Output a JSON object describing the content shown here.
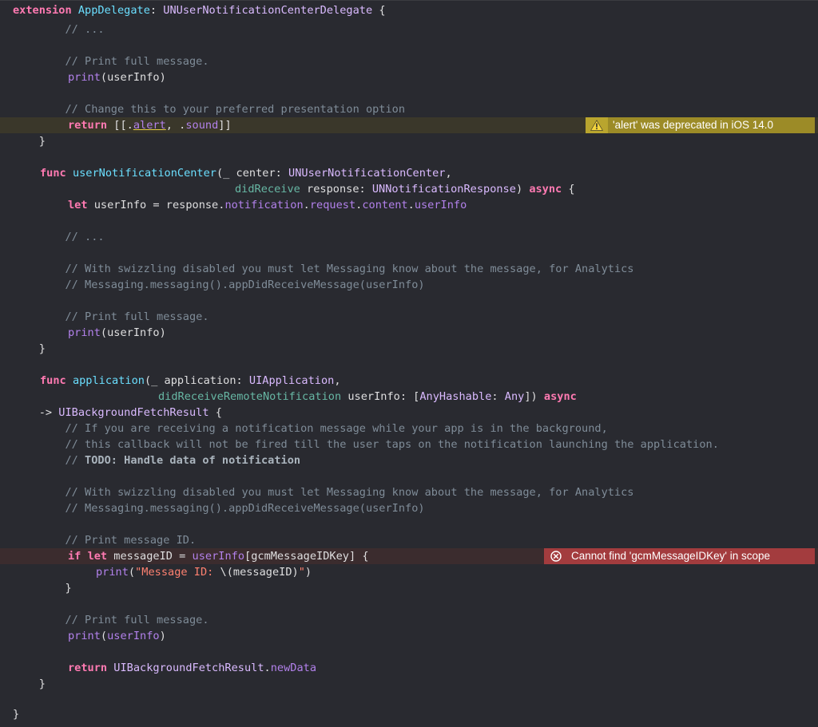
{
  "code": {
    "l1": {
      "kw": "extension",
      "type": "AppDelegate",
      "colon": ": ",
      "proto": "UNUserNotificationCenterDelegate",
      "rest": " {"
    },
    "l2": {
      "text": "        // ..."
    },
    "l4": {
      "text": "        // Print full message."
    },
    "l5": {
      "fn": "print",
      "rest": "(userInfo)"
    },
    "l7": {
      "text": "        // Change this to your preferred presentation option"
    },
    "l8": {
      "kw": "return",
      "a": " [[.",
      "alert": "alert",
      "b": ", .",
      "sound": "sound",
      "c": "]]"
    },
    "l9": {
      "text": "    }"
    },
    "l11": {
      "kw": "func",
      "name": "userNotificationCenter",
      "a": "(_ center: ",
      "type": "UNUserNotificationCenter",
      "b": ","
    },
    "l12": {
      "label": "didReceive",
      "a": " response: ",
      "type": "UNNotificationResponse",
      "b": ") ",
      "kw": "async",
      "c": " {"
    },
    "l13": {
      "kw": "let",
      "a": " userInfo = response.",
      "p1": "notification",
      "d1": ".",
      "p2": "request",
      "d2": ".",
      "p3": "content",
      "d3": ".",
      "p4": "userInfo"
    },
    "l15": {
      "text": "        // ..."
    },
    "l17": {
      "text": "        // With swizzling disabled you must let Messaging know about the message, for Analytics"
    },
    "l18": {
      "text": "        // Messaging.messaging().appDidReceiveMessage(userInfo)"
    },
    "l20": {
      "text": "        // Print full message."
    },
    "l21": {
      "fn": "print",
      "rest": "(userInfo)"
    },
    "l22": {
      "text": "    }"
    },
    "l24": {
      "kw": "func",
      "name": "application",
      "a": "(_ application: ",
      "type": "UIApplication",
      "b": ","
    },
    "l25": {
      "label": "didReceiveRemoteNotification",
      "a": " userInfo: [",
      "t1": "AnyHashable",
      "b": ": ",
      "t2": "Any",
      "c": "]) ",
      "kw": "async"
    },
    "l26": {
      "a": "    -> ",
      "type": "UIBackgroundFetchResult",
      "b": " {"
    },
    "l27": {
      "text": "        // If you are receiving a notification message while your app is in the background,"
    },
    "l28": {
      "text": "        // this callback will not be fired till the user taps on the notification launching the application."
    },
    "l29": {
      "prefix": "        // ",
      "bold": "TODO: Handle data of notification"
    },
    "l31": {
      "text": "        // With swizzling disabled you must let Messaging know about the message, for Analytics"
    },
    "l32": {
      "text": "        // Messaging.messaging().appDidReceiveMessage(userInfo)"
    },
    "l34": {
      "text": "        // Print message ID."
    },
    "l35": {
      "kw1": "if",
      "sp": " ",
      "kw2": "let",
      "a": " messageID = ",
      "p": "userInfo",
      "b": "[gcmMessageIDKey] {"
    },
    "l36": {
      "fn": "print",
      "a": "(",
      "str1": "\"Message ID: ",
      "interp": "\\(messageID)",
      "str2": "\"",
      "b": ")"
    },
    "l37": {
      "text": "        }"
    },
    "l39": {
      "text": "        // Print full message."
    },
    "l40": {
      "fn": "print",
      "a": "(",
      "p": "userInfo",
      "b": ")"
    },
    "l42": {
      "kw": "return",
      "a": " ",
      "type": "UIBackgroundFetchResult",
      "d": ".",
      "p": "newData"
    },
    "l43": {
      "text": "    }"
    },
    "l45": {
      "text": "}"
    }
  },
  "issues": {
    "warning": {
      "icon": "warning-triangle-icon",
      "message": "'alert' was deprecated in iOS 14.0"
    },
    "error": {
      "icon": "error-x-circle-icon",
      "message": "Cannot find 'gcmMessageIDKey' in scope"
    }
  },
  "colors": {
    "background": "#292a30",
    "keyword": "#ff7ab2",
    "comment": "#7f8c98",
    "warning_bar": "#9c8b27",
    "error_bar": "#a33c3e"
  }
}
